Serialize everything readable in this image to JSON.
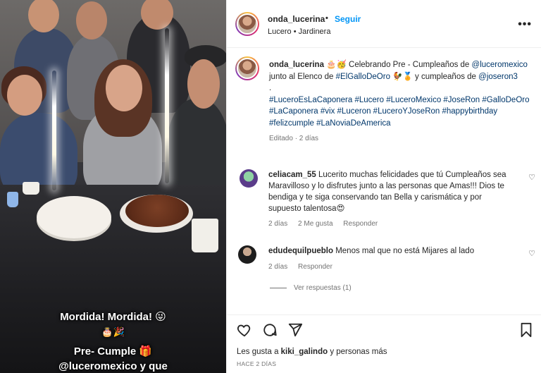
{
  "post": {
    "username": "onda_lucerina",
    "follow_label": "Seguir",
    "separator": "•",
    "location": "Lucero • Jardinera",
    "more_label": "•••"
  },
  "caption": {
    "username": "onda_lucerina",
    "emojis_lead": "🎂🥳",
    "text_1": " Celebrando Pre - Cumpleaños de ",
    "mention_1": "@luceromexico",
    "text_2": " junto al Elenco de ",
    "tag_gallo": "#ElGalloDeOro",
    "emojis_mid": " 🐓🏅",
    "text_3": " y cumpleaños de ",
    "mention_2": "@joseron3",
    "dot": ".",
    "hashtags": "#LuceroEsLaCaponera #Lucero #LuceroMexico #JoseRon #GalloDeOro #LaCaponera #vix #Luceron #LuceroYJoseRon #happybirthday #felizcumple #LaNoviaDeAmerica",
    "edited": "Editado · 2 días"
  },
  "comments": [
    {
      "username": "celiacam_55",
      "text": "Lucerito muchas felicidades que tú Cumpleaños sea Maravilloso y lo disfrutes junto a las personas que Amas!!! Dios te bendiga y te siga conservando tan Bella y carismática y por supuesto talentosa😍",
      "time": "2 días",
      "likes": "2 Me gusta",
      "reply": "Responder"
    },
    {
      "username": "edudequilpueblo",
      "text": "Menos mal que no está Mijares al lado",
      "time": "2 días",
      "reply": "Responder"
    }
  ],
  "view_replies": "Ver respuestas (1)",
  "likes": {
    "prefix": "Les gusta a ",
    "user": "kiki_galindo",
    "suffix": " y personas más"
  },
  "date": "HACE 2 DÍAS",
  "overlay": {
    "line1": "Mordida! Mordida! 😜",
    "line2": "🎂🎉",
    "line3": "Pre- Cumple 🎁",
    "line4": "@luceromexico y que"
  },
  "icons": [
    "heart-icon",
    "comment-icon",
    "share-icon",
    "bookmark-icon",
    "more-icon"
  ],
  "colors": {
    "link": "#00376b",
    "follow": "#0095f6",
    "meta": "#737373"
  }
}
